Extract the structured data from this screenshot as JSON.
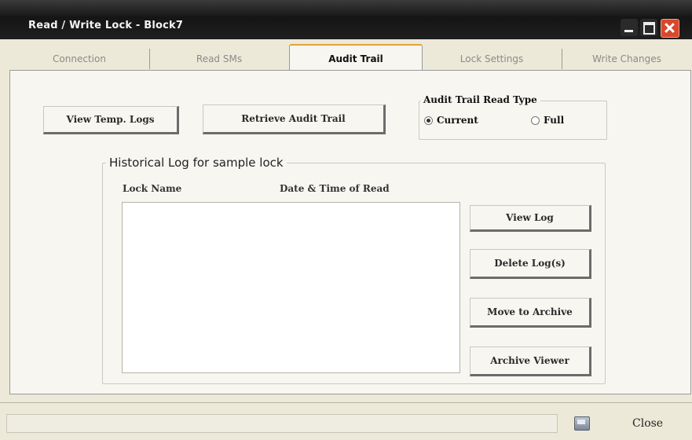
{
  "window": {
    "title": "Read / Write Lock - Block7"
  },
  "tabs": [
    {
      "label": "Connection",
      "active": false
    },
    {
      "label": "Read SMs",
      "active": false
    },
    {
      "label": "Audit Trail",
      "active": true
    },
    {
      "label": "Lock Settings",
      "active": false
    },
    {
      "label": "Write Changes",
      "active": false
    }
  ],
  "toolbar": {
    "view_temp_logs": "View Temp. Logs",
    "retrieve_audit_trail": "Retrieve Audit Trail"
  },
  "read_type": {
    "label": "Audit Trail Read Type",
    "options": [
      {
        "label": "Current",
        "checked": true
      },
      {
        "label": "Full",
        "checked": false
      }
    ]
  },
  "historical": {
    "title": "Historical Log for sample lock",
    "columns": [
      "Lock Name",
      "Date & Time of Read"
    ],
    "rows": []
  },
  "actions": {
    "view_log": "View Log",
    "delete_logs": "Delete Log(s)",
    "move_to_archive": "Move to Archive",
    "archive_viewer": "Archive Viewer"
  },
  "footer": {
    "close_label": "Close",
    "help_icon": "help-icon"
  }
}
